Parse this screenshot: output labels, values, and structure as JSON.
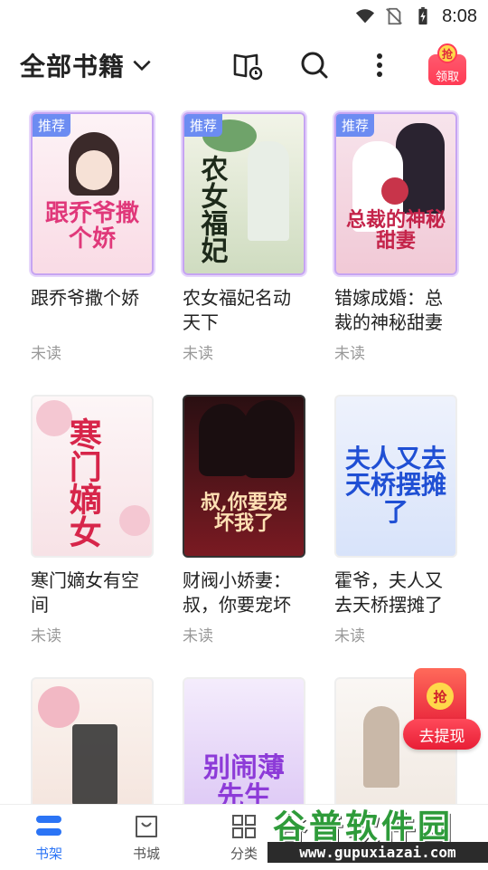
{
  "status_bar": {
    "time": "8:08"
  },
  "header": {
    "title": "全部书籍",
    "claim_label": "领取",
    "claim_seal": "抢"
  },
  "books": [
    {
      "title": "跟乔爷撒个娇",
      "status": "未读",
      "tag": "推荐",
      "cover_text": "跟乔爷撒个娇",
      "cover_color": "#fbe9ef"
    },
    {
      "title": "农女福妃名动天下",
      "status": "未读",
      "tag": "推荐",
      "cover_text": "农女福妃",
      "cover_color": "#dfe7cf"
    },
    {
      "title": "错嫁成婚：总裁的神秘甜妻",
      "status": "未读",
      "tag": "推荐",
      "cover_text": "总裁的神秘甜妻",
      "cover_color": "#f6d6e0"
    },
    {
      "title": "寒门嫡女有空间",
      "status": "未读",
      "tag": "",
      "cover_text": "寒门嫡女",
      "cover_color": "#fbeef0"
    },
    {
      "title": "财阀小娇妻：叔，你要宠坏",
      "status": "未读",
      "tag": "",
      "cover_text": "叔,你要宠坏我了",
      "cover_color": "#3a1418"
    },
    {
      "title": "霍爷，夫人又去天桥摆摊了",
      "status": "未读",
      "tag": "",
      "cover_text": "夫人又去天桥摆摊了",
      "cover_color": "#e3eaf9"
    },
    {
      "title": "",
      "status": "",
      "tag": "",
      "cover_text": "",
      "cover_color": "#f7ece6"
    },
    {
      "title": "",
      "status": "",
      "tag": "",
      "cover_text": "别闹薄先生",
      "cover_color": "#e9dcf7"
    },
    {
      "title": "",
      "status": "",
      "tag": "",
      "cover_text": "",
      "cover_color": "#f4f0ec"
    }
  ],
  "floating_gift": {
    "seal": "抢",
    "label": "去提现"
  },
  "bottom_nav": [
    {
      "label": "书架",
      "icon": "bookshelf-icon",
      "active": true
    },
    {
      "label": "书城",
      "icon": "store-bag-icon",
      "active": false
    },
    {
      "label": "分类",
      "icon": "grid-icon",
      "active": false
    }
  ],
  "watermark": {
    "main": "谷普软件园",
    "url": "www.gupuxiazai.com"
  },
  "colors": {
    "accent": "#2b74f5",
    "recommend_tag": "#6c8cf2",
    "red": "#ff3b55",
    "watermark_green": "#2e9b3a"
  }
}
